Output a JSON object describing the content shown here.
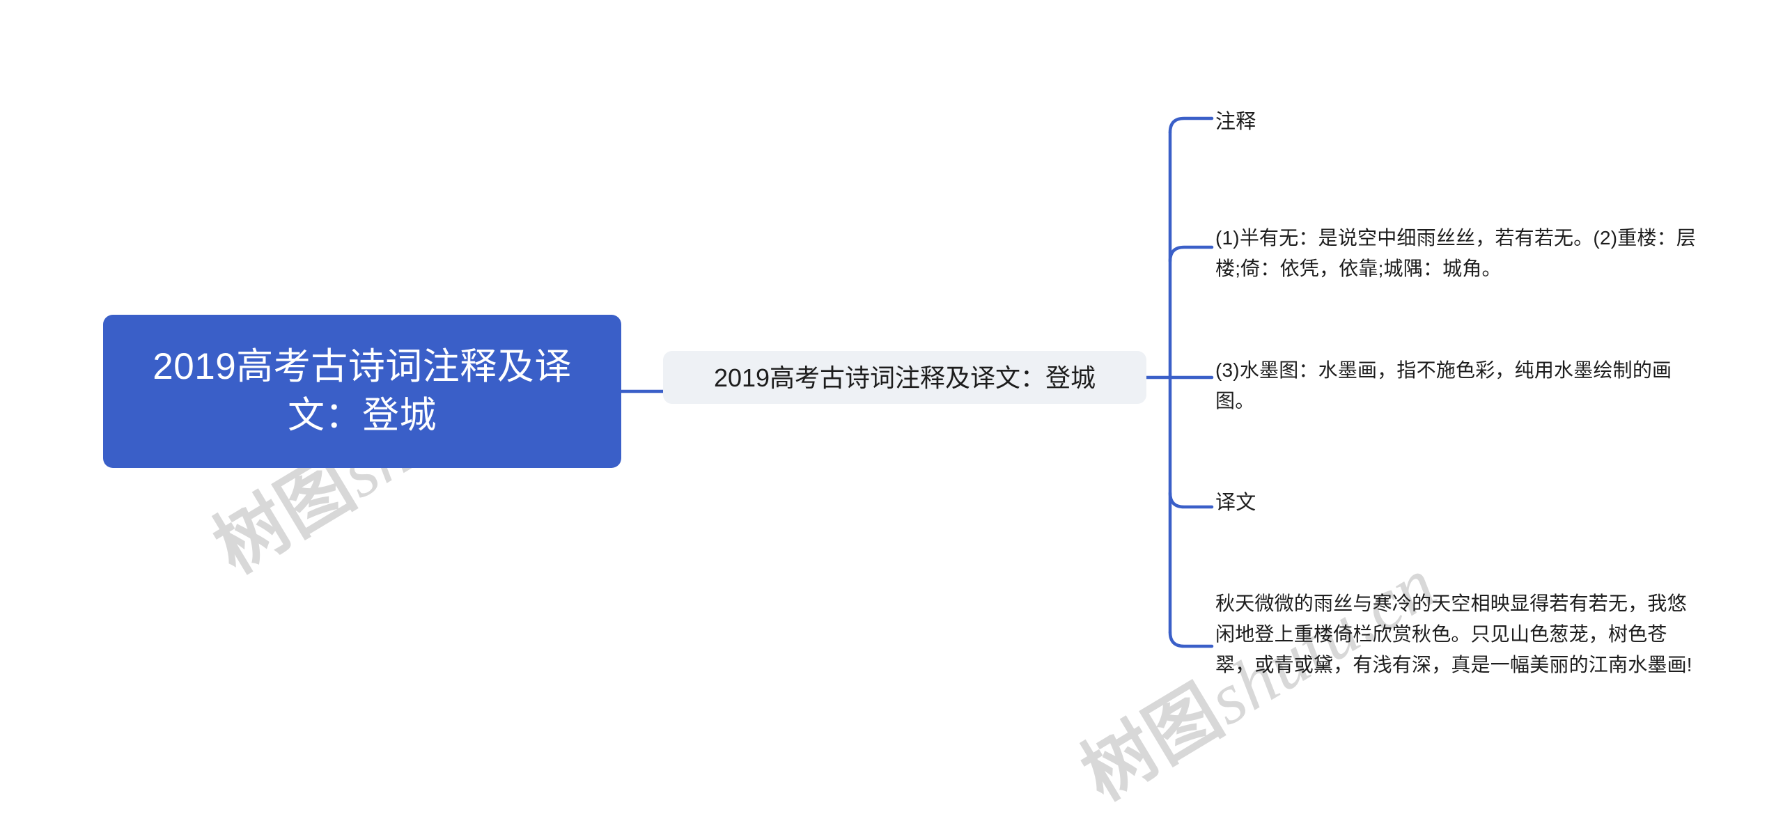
{
  "diagram": {
    "type": "mind-map",
    "orientation": "left-to-right",
    "colors": {
      "root_fill": "#3a5fc8",
      "root_text": "#ffffff",
      "topic_fill": "#eef1f5",
      "topic_text": "#1d1d1d",
      "connector": "#3a5fc8",
      "leaf_text": "#1d1d1d",
      "background": "#ffffff",
      "watermark": "#d8d8d8"
    },
    "root": {
      "label": "2019高考古诗词注释及译文：登城"
    },
    "topic": {
      "label": "2019高考古诗词注释及译文：登城"
    },
    "branches": [
      {
        "id": "zhushi-heading",
        "label": "注释"
      },
      {
        "id": "zhushi-1-2",
        "label": "(1)半有无：是说空中细雨丝丝，若有若无。(2)重楼：层楼;倚：依凭，依靠;城隅：城角。"
      },
      {
        "id": "zhushi-3",
        "label": "(3)水墨图：水墨画，指不施色彩，纯用水墨绘制的画图。"
      },
      {
        "id": "yiwen-heading",
        "label": "译文"
      },
      {
        "id": "yiwen-body",
        "label": "秋天微微的雨丝与寒冷的天空相映显得若有若无，我悠闲地登上重楼倚栏欣赏秋色。只见山色葱茏，树色苍翠，或青或黛，有浅有深，真是一幅美丽的江南水墨画!"
      }
    ],
    "watermark": {
      "text_cn": "树图",
      "text_en": "shutu.cn"
    }
  }
}
